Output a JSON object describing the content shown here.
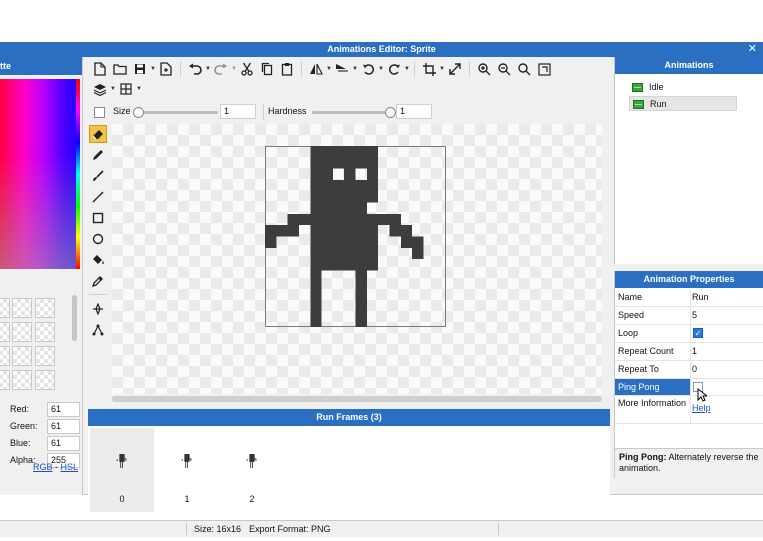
{
  "window": {
    "title": "Animations Editor: Sprite",
    "close_glyph": "✕"
  },
  "palette": {
    "title": "tte",
    "red_label": "Red:",
    "red": "61",
    "green_label": "Green:",
    "green": "61",
    "blue_label": "Blue:",
    "blue": "61",
    "alpha_label": "Alpha:",
    "alpha": "255",
    "mode_rgb": "RGB",
    "mode_sep": " - ",
    "mode_hsl": "HSL"
  },
  "toolbar": {
    "icons": [
      "new-file-icon",
      "open-folder-icon",
      "save-icon",
      "export-icon",
      "undo-icon",
      "redo-icon",
      "cut-icon",
      "copy-icon",
      "paste-icon",
      "flip-horizontal-icon",
      "flip-vertical-icon",
      "rotate-left-icon",
      "rotate-right-icon",
      "crop-icon",
      "resize-icon",
      "zoom-in-icon",
      "zoom-out-icon",
      "zoom-fit-icon",
      "zoom-actual-icon",
      "layers-icon",
      "grid-icon"
    ]
  },
  "brush": {
    "size_label": "Size",
    "size_value": "1",
    "hardness_label": "Hardness",
    "hardness_value": "1"
  },
  "tools": [
    "eraser-tool",
    "pencil-tool",
    "brush-tool",
    "line-tool",
    "rectangle-tool",
    "ellipse-tool",
    "fill-tool",
    "eyedropper-tool",
    "select-tool",
    "bone-tool"
  ],
  "frames": {
    "header": "Run Frames (3)",
    "items": [
      {
        "label": "0"
      },
      {
        "label": "1"
      },
      {
        "label": "2"
      }
    ],
    "selected_index": 0
  },
  "status": {
    "size": "Size: 16x16",
    "export": "Export Format: PNG"
  },
  "animations": {
    "header": "Animations",
    "items": [
      {
        "label": "Idle"
      },
      {
        "label": "Run"
      }
    ],
    "selected": "Run"
  },
  "properties": {
    "header": "Animation Properties",
    "name_label": "Name",
    "name_value": "Run",
    "speed_label": "Speed",
    "speed_value": "5",
    "loop_label": "Loop",
    "loop_checked": true,
    "repeat_count_label": "Repeat Count",
    "repeat_count_value": "1",
    "repeat_to_label": "Repeat To",
    "repeat_to_value": "0",
    "ping_pong_label": "Ping Pong",
    "ping_pong_checked": false,
    "more_info_label": "More Information",
    "help_link": "Help"
  },
  "description": {
    "title": "Ping Pong:",
    "text": " Alternately reverse the animation."
  },
  "colors": {
    "accent": "#2a6fc2",
    "sprite": "#3d3d3d",
    "active_tool": "#f5c242"
  }
}
